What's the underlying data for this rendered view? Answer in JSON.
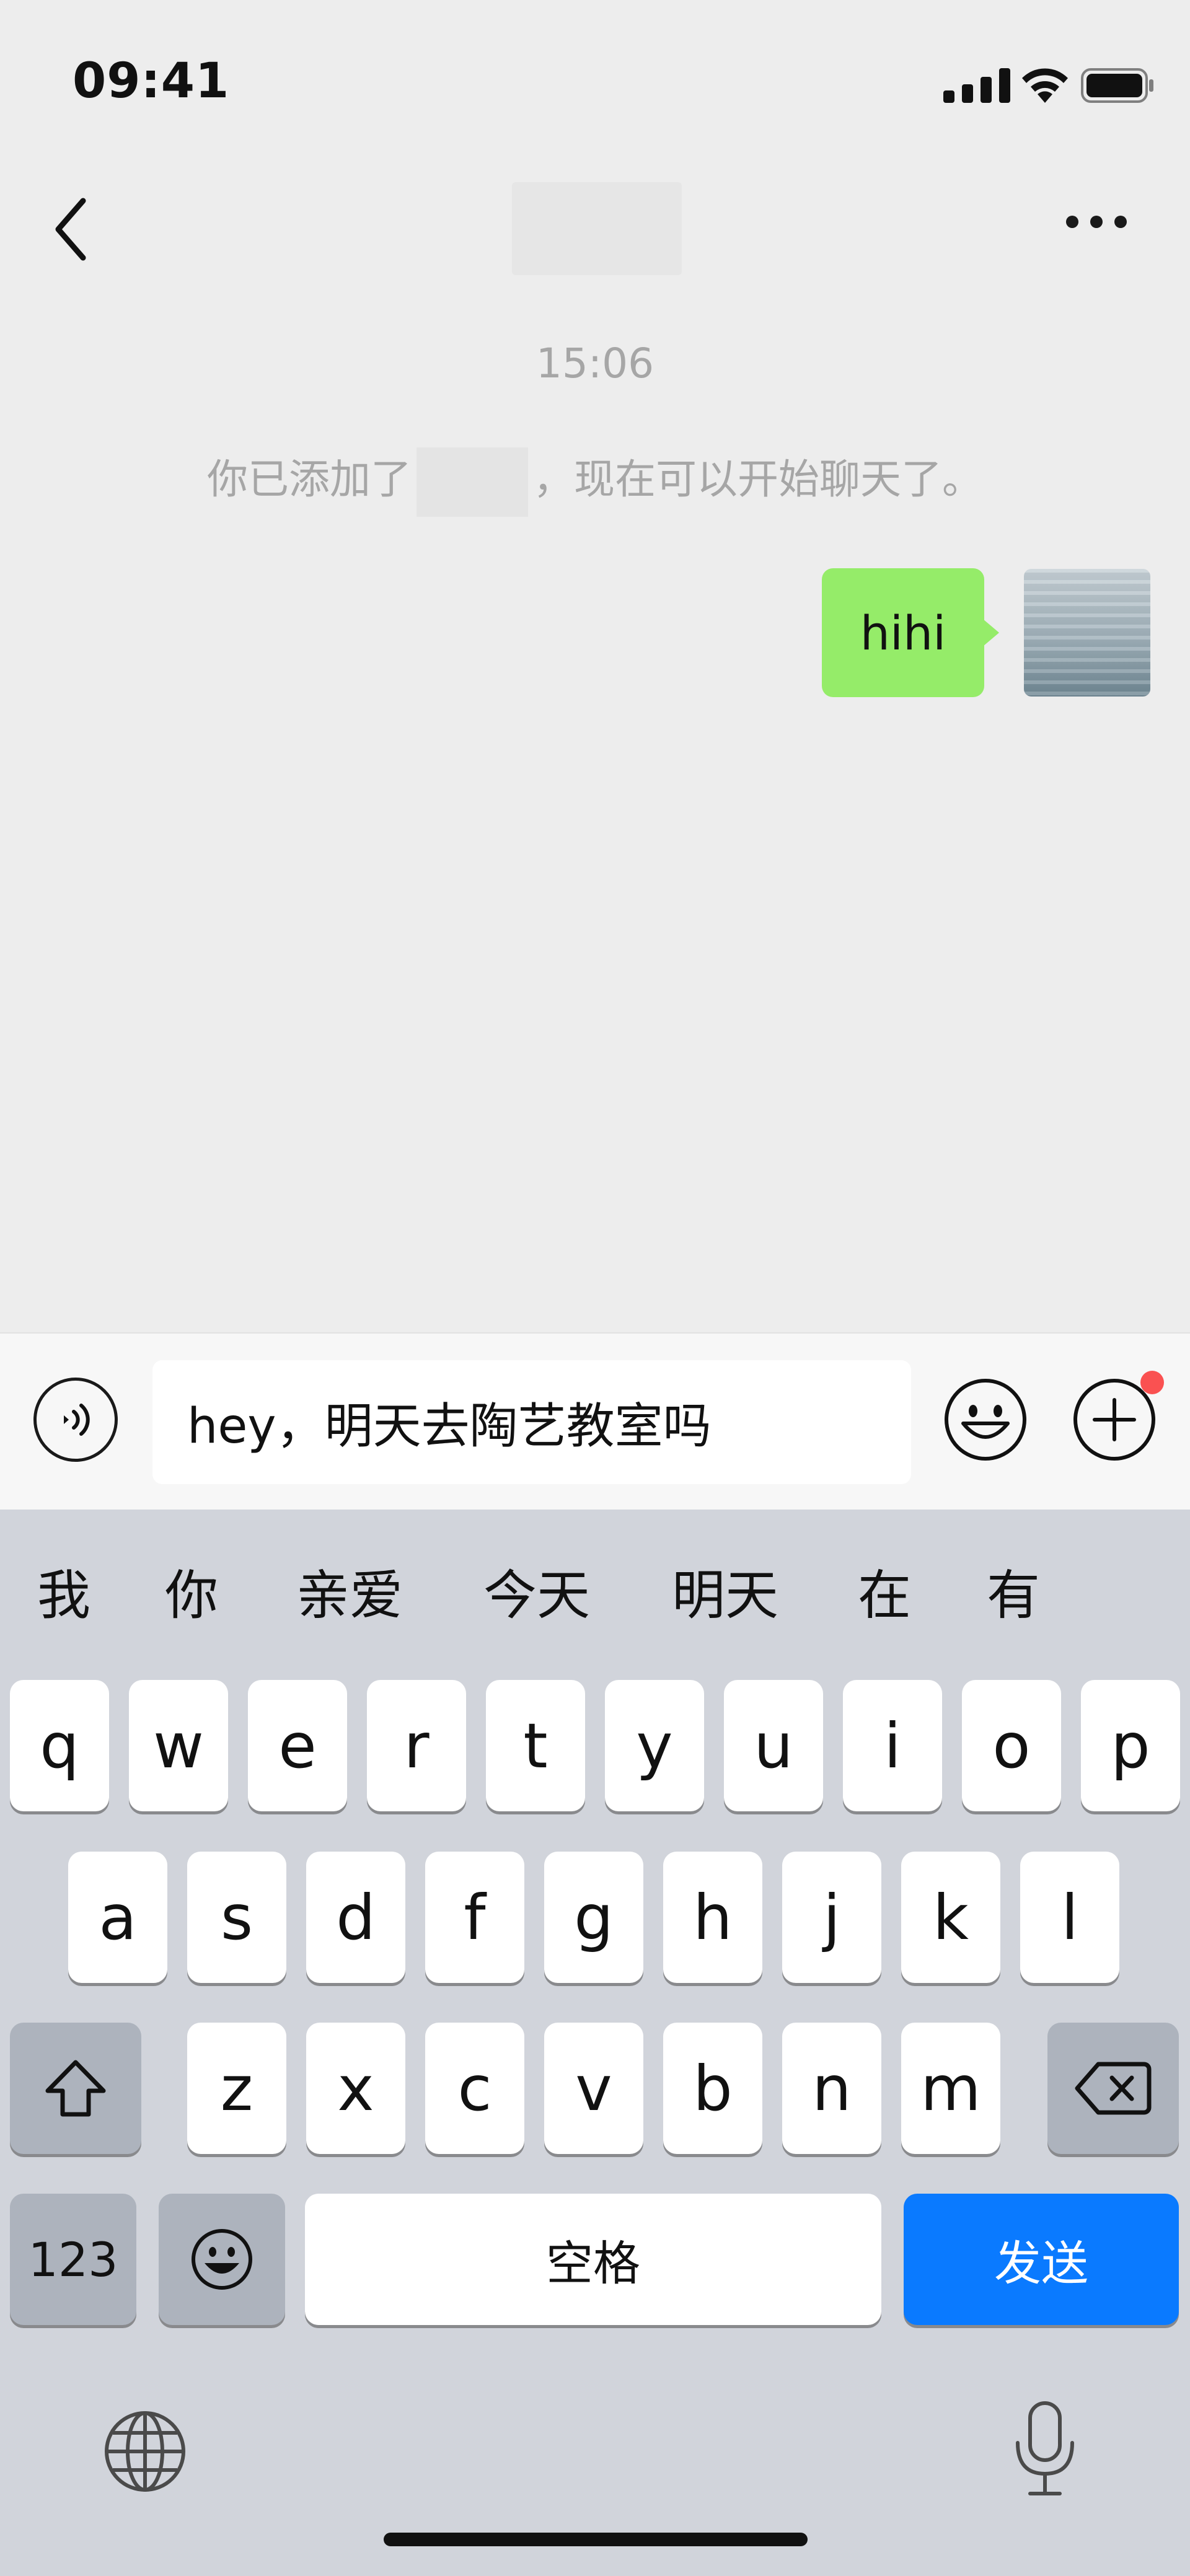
{
  "status_bar": {
    "time": "09:41"
  },
  "chat": {
    "timestamp": "15:06",
    "system_message_prefix": "你已添加了",
    "system_message_suffix": "，现在可以开始聊天了。",
    "messages": [
      {
        "text": "hihi",
        "from": "me"
      }
    ]
  },
  "input": {
    "value": "hey，明天去陶艺教室吗"
  },
  "keyboard": {
    "suggestions": [
      "我",
      "你",
      "亲爱",
      "今天",
      "明天",
      "在",
      "有"
    ],
    "row1": [
      "q",
      "w",
      "e",
      "r",
      "t",
      "y",
      "u",
      "i",
      "o",
      "p"
    ],
    "row2": [
      "a",
      "s",
      "d",
      "f",
      "g",
      "h",
      "j",
      "k",
      "l"
    ],
    "row3": [
      "z",
      "x",
      "c",
      "v",
      "b",
      "n",
      "m"
    ],
    "numbers_label": "123",
    "space_label": "空格",
    "send_label": "发送"
  },
  "colors": {
    "bubble": "#95EC69",
    "send": "#0A7AFF",
    "badge": "#FA5151"
  },
  "icons": [
    "back-icon",
    "more-icon",
    "voice-icon",
    "emoji-icon",
    "plus-icon",
    "shift-icon",
    "delete-icon",
    "emoji-key-icon",
    "globe-icon",
    "mic-icon"
  ]
}
